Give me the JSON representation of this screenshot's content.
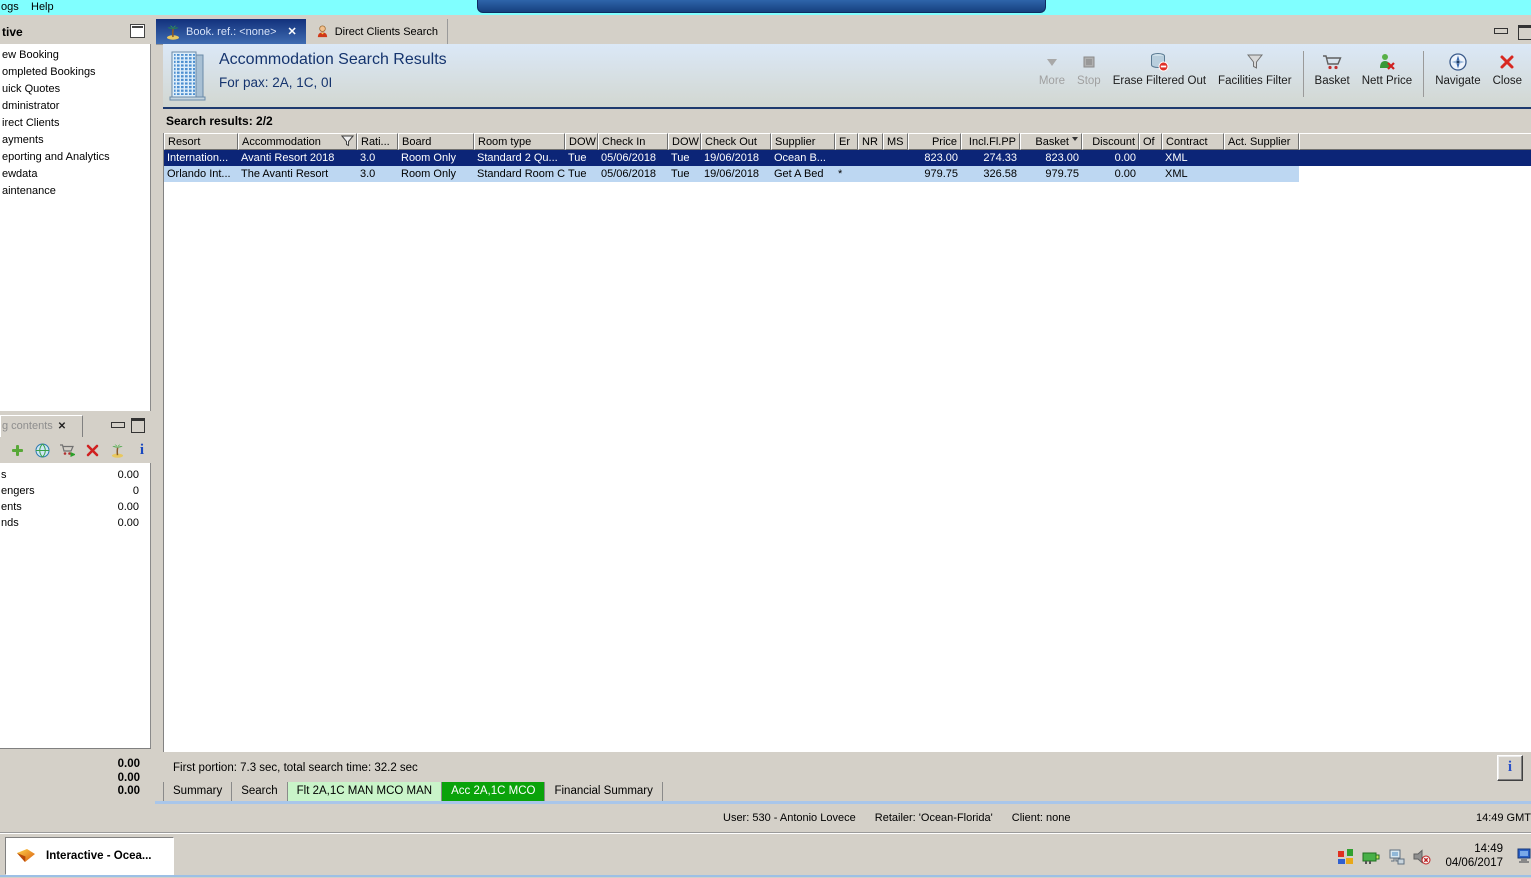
{
  "menu": {
    "logs": "ogs",
    "help": "Help"
  },
  "sidebar": {
    "title": "tive",
    "items": [
      "ew Booking",
      "ompleted Bookings",
      "uick Quotes",
      "dministrator",
      "irect Clients",
      "ayments",
      "eporting and Analytics",
      "ewdata",
      "aintenance"
    ]
  },
  "contents_panel": {
    "tab_label": "g contents",
    "rows": [
      {
        "label": "s",
        "value": "0.00"
      },
      {
        "label": "engers",
        "value": "0"
      },
      {
        "label": "ents",
        "value": "0.00"
      },
      {
        "label": "nds",
        "value": "0.00"
      }
    ],
    "totals": [
      "0.00",
      "0.00",
      "0.00"
    ]
  },
  "main_tabs": [
    {
      "label": "Book. ref.: <none>",
      "icon": "palm-tree-icon"
    },
    {
      "label": "Direct Clients Search",
      "icon": "person-icon"
    }
  ],
  "icons": {
    "close_tab": "✕",
    "info": "i"
  },
  "header": {
    "title": "Accommodation Search Results",
    "subtitle": "For pax: 2A, 1C, 0I"
  },
  "toolbar": {
    "buttons": [
      {
        "label": "More",
        "icon": "more-icon",
        "disabled": true
      },
      {
        "label": "Stop",
        "icon": "stop-icon",
        "disabled": true
      },
      {
        "label": "Erase Filtered Out",
        "icon": "erase-filtered-icon",
        "disabled": false
      },
      {
        "label": "Facilities Filter",
        "icon": "facilities-filter-icon",
        "disabled": false
      },
      {
        "label": "Basket",
        "icon": "basket-icon",
        "disabled": false
      },
      {
        "label": "Nett Price",
        "icon": "nett-price-icon",
        "disabled": false
      },
      {
        "label": "Navigate",
        "icon": "navigate-icon",
        "disabled": false
      },
      {
        "label": "Close",
        "icon": "close-icon",
        "disabled": false
      }
    ]
  },
  "search_results_label": "Search results: 2/2",
  "table": {
    "columns": [
      "Resort",
      "Accommodation",
      "Rati...",
      "Board",
      "Room type",
      "DOW",
      "Check In",
      "DOW",
      "Check Out",
      "Supplier",
      "Er",
      "NR",
      "MS",
      "Price",
      "Incl.Fl.PP",
      "Basket",
      "Discount",
      "Of",
      "Contract",
      "Act. Supplier",
      ""
    ],
    "rows": [
      {
        "cells": [
          "Internation...",
          "Avanti Resort 2018",
          "3.0",
          "Room Only",
          "Standard 2 Qu...",
          "Tue",
          "05/06/2018",
          "Tue",
          "19/06/2018",
          "Ocean B...",
          "",
          "",
          "",
          "823.00",
          "274.33",
          "823.00",
          "0.00",
          "",
          "XML",
          "",
          ""
        ]
      },
      {
        "cells": [
          "Orlando Int...",
          "The Avanti Resort",
          "3.0",
          "Room Only",
          "Standard Room C",
          "Tue",
          "05/06/2018",
          "Tue",
          "19/06/2018",
          "Get A Bed",
          "*",
          "",
          "",
          "979.75",
          "326.58",
          "979.75",
          "0.00",
          "",
          "XML",
          "",
          ""
        ]
      }
    ]
  },
  "status_line": "First portion: 7.3 sec, total search time: 32.2 sec",
  "bottom_tabs": [
    {
      "label": "Summary"
    },
    {
      "label": "Search"
    },
    {
      "label": "Flt 2A,1C MAN MCO MAN"
    },
    {
      "label": "Acc 2A,1C MCO"
    },
    {
      "label": "Financial Summary"
    }
  ],
  "status_bar": {
    "user": "User: 530 - Antonio Lovece",
    "retailer": "Retailer: 'Ocean-Florida'",
    "client": "Client: none",
    "gmt_time": "14:49 GMT"
  },
  "taskbar": {
    "app_button": "Interactive - Ocea...",
    "tray_time": "14:49",
    "tray_date": "04/06/2017"
  },
  "colors": {
    "top_strip": "#80ffff",
    "selected_row": "#0c2577",
    "row_alt": "#bdd7f2",
    "green_tab": "#0aa30a",
    "light_green_tab": "#c9f4c9",
    "blue_edge": "#a9c6ea"
  }
}
